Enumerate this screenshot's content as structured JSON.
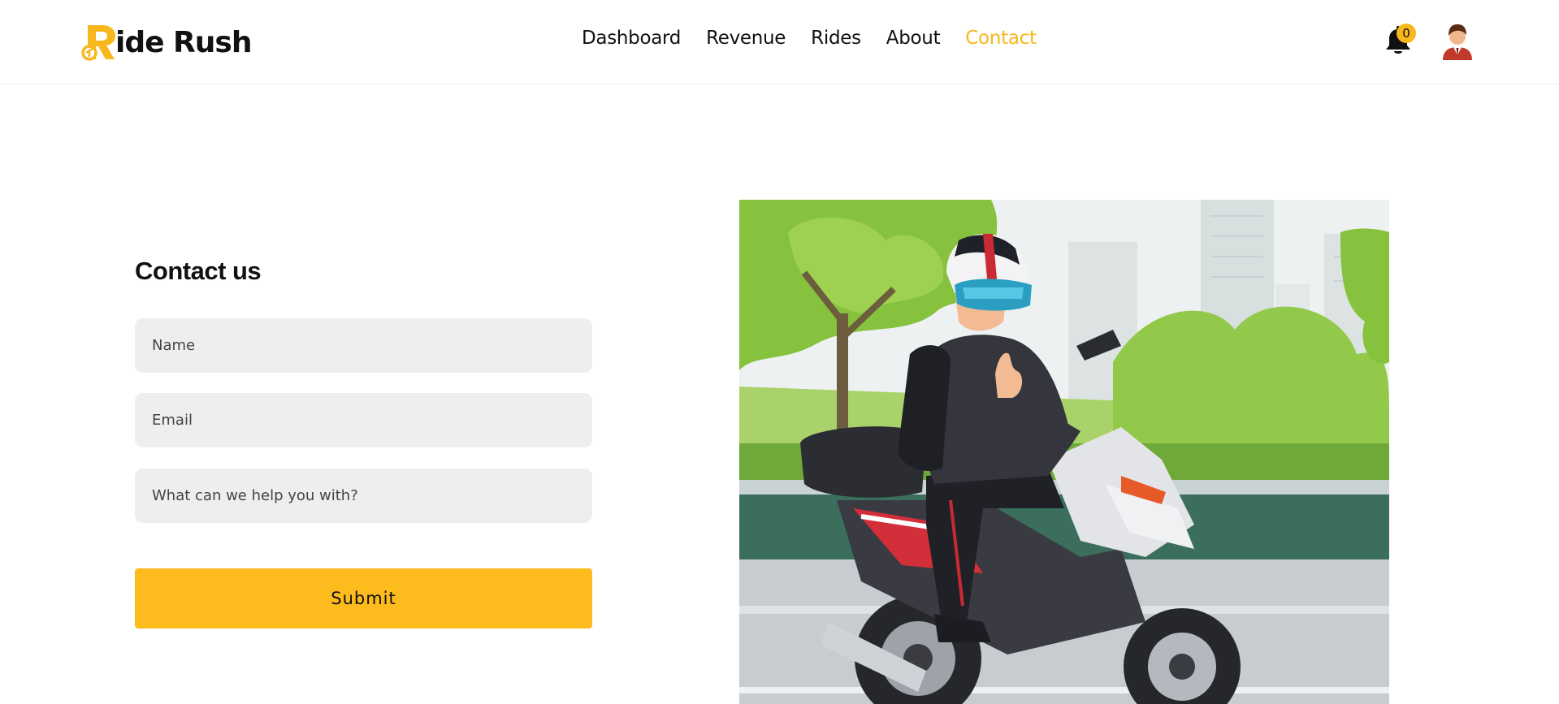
{
  "brand": {
    "name": "ide Rush",
    "accent": "#f7b71d"
  },
  "nav": {
    "items": [
      {
        "label": "Dashboard"
      },
      {
        "label": "Revenue"
      },
      {
        "label": "Rides"
      },
      {
        "label": "About"
      },
      {
        "label": "Contact"
      }
    ],
    "active": "Contact"
  },
  "header": {
    "notification_count": "0",
    "icons": [
      "bell-icon",
      "user-avatar"
    ]
  },
  "contact": {
    "title": "Contact us",
    "name_placeholder": "Name",
    "email_placeholder": "Email",
    "message_placeholder": "What can we help you with?",
    "submit_label": "Submit"
  },
  "colors": {
    "accent": "#f7b71d",
    "button": "#fdbb1e",
    "field_bg": "#eeeeee"
  }
}
